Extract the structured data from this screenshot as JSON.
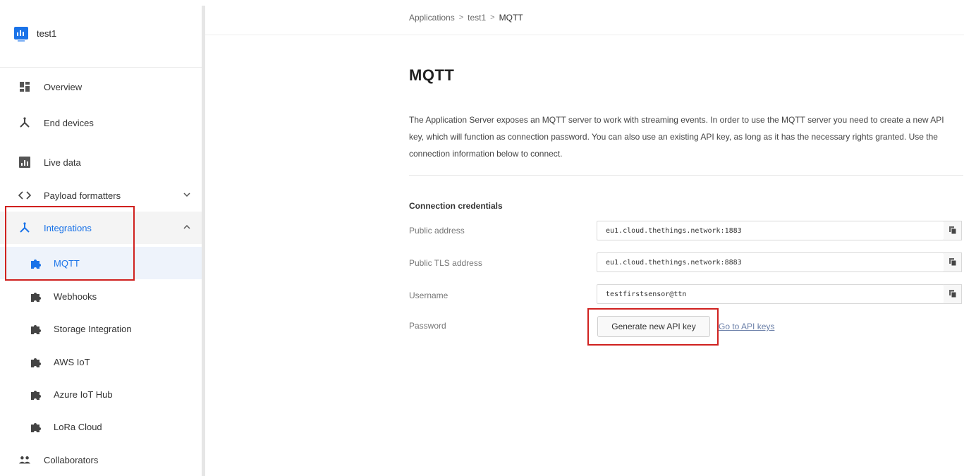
{
  "app": {
    "name": "test1"
  },
  "sidebar": {
    "items": [
      {
        "label": "Overview",
        "icon": "overview-icon"
      },
      {
        "label": "End devices",
        "icon": "end-devices-icon"
      },
      {
        "label": "Live data",
        "icon": "live-data-icon"
      },
      {
        "label": "Payload formatters",
        "icon": "code-icon",
        "expanded": false
      },
      {
        "label": "Integrations",
        "icon": "integrations-icon",
        "expanded": true
      },
      {
        "label": "Collaborators",
        "icon": "collaborators-icon"
      }
    ],
    "integrations": [
      {
        "label": "MQTT",
        "active": true
      },
      {
        "label": "Webhooks"
      },
      {
        "label": "Storage Integration"
      },
      {
        "label": "AWS IoT"
      },
      {
        "label": "Azure IoT Hub"
      },
      {
        "label": "LoRa Cloud"
      }
    ],
    "chevron_down": "⌄",
    "chevron_up": "^"
  },
  "breadcrumb": {
    "items": [
      "Applications",
      "test1",
      "MQTT"
    ],
    "separator": ">"
  },
  "main": {
    "title": "MQTT",
    "description": "The Application Server exposes an MQTT server to work with streaming events. In order to use the MQTT server you need to create a new API key, which will function as connection password. You can also use an existing API key, as long as it has the necessary rights granted. Use the connection information below to connect.",
    "section_title": "Connection credentials",
    "fields": [
      {
        "label": "Public address",
        "value": "eu1.cloud.thethings.network:1883"
      },
      {
        "label": "Public TLS address",
        "value": "eu1.cloud.thethings.network:8883"
      },
      {
        "label": "Username",
        "value": "testfirstsensor@ttn"
      },
      {
        "label": "Password"
      }
    ],
    "generate_button": "Generate new API key",
    "api_keys_link": "Go to API keys"
  },
  "colors": {
    "accent": "#1a73e8",
    "highlight_border": "#d0211f"
  }
}
